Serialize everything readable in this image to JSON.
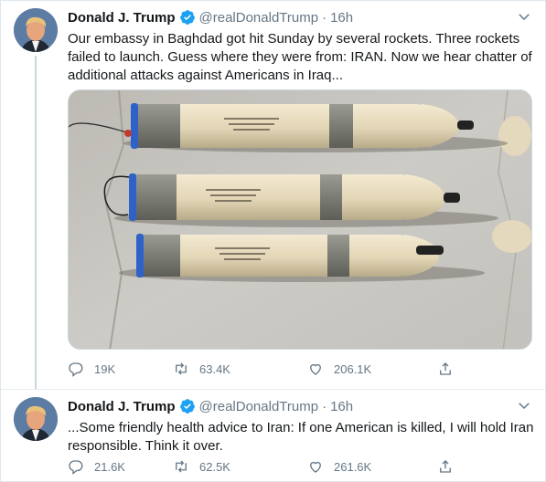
{
  "tweets": [
    {
      "author": "Donald J. Trump",
      "handle": "@realDonaldTrump",
      "separator": "·",
      "time": "16h",
      "text": "Our embassy in Baghdad got hit Sunday by several rockets. Three rockets failed to launch. Guess where they were from: IRAN. Now we hear chatter of additional attacks against Americans in Iraq...",
      "replies": "19K",
      "retweets": "63.4K",
      "likes": "206.1K"
    },
    {
      "author": "Donald J. Trump",
      "handle": "@realDonaldTrump",
      "separator": "·",
      "time": "16h",
      "text": "...Some friendly health advice to Iran: If one American is killed, I will hold Iran responsible. Think it over.",
      "replies": "21.6K",
      "retweets": "62.5K",
      "likes": "261.6K"
    }
  ],
  "colors": {
    "verified": "#1da1f2",
    "secondary_text": "#657786",
    "thread_line": "#ccd6dd",
    "rocket_body": "#e8dcc0",
    "rocket_band": "#7d7f76"
  },
  "icons": [
    "verified-badge-icon",
    "chevron-down-icon",
    "reply-icon",
    "retweet-icon",
    "like-icon",
    "share-icon"
  ]
}
